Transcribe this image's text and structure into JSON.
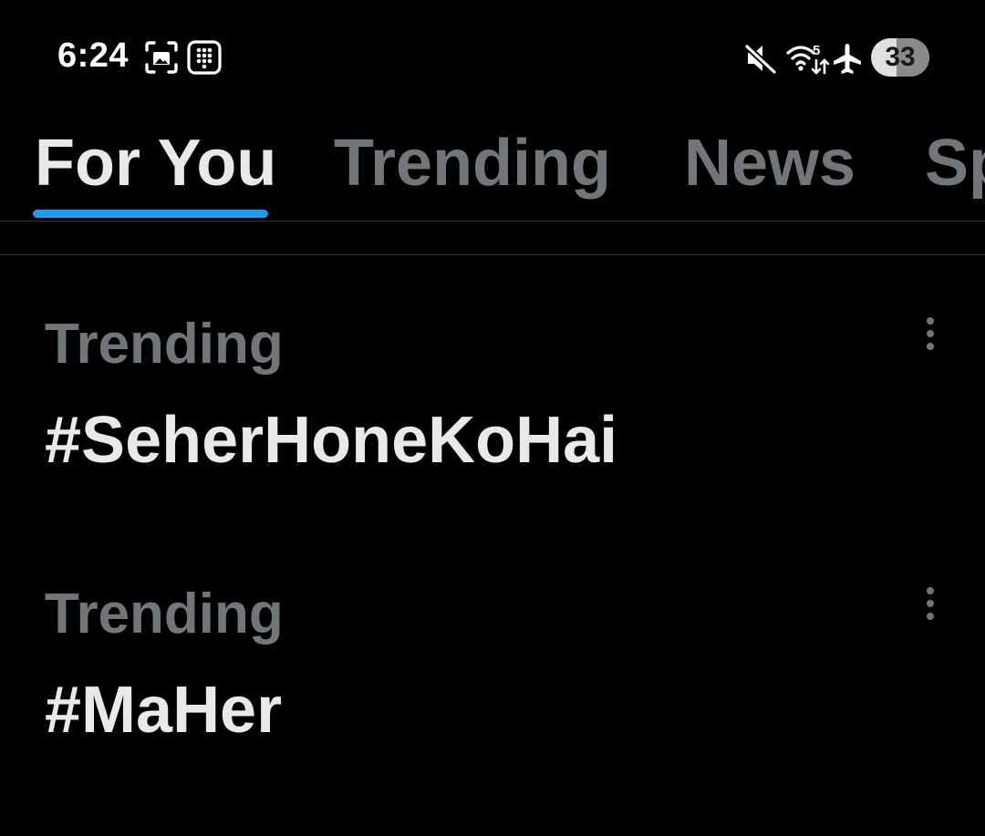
{
  "status_bar": {
    "time": "6:24",
    "battery_level": "33",
    "icons": [
      "screenshot-icon",
      "keypad-icon",
      "mute-icon",
      "wifi-icon",
      "airplane-mode-icon"
    ],
    "wifi_badge": "5"
  },
  "tabs": [
    {
      "label": "For You",
      "active": true
    },
    {
      "label": "Trending",
      "active": false
    },
    {
      "label": "News",
      "active": false
    },
    {
      "label": "Sp",
      "active": false
    }
  ],
  "trends": [
    {
      "context": "Trending",
      "title": "#SeherHoneKoHai"
    },
    {
      "context": "Trending",
      "title": "#MaHer"
    }
  ],
  "colors": {
    "background": "#000000",
    "accent": "#1d9bf0",
    "primary_text": "#e7e9ea",
    "secondary_text": "#71767b",
    "divider": "#2f3336"
  }
}
